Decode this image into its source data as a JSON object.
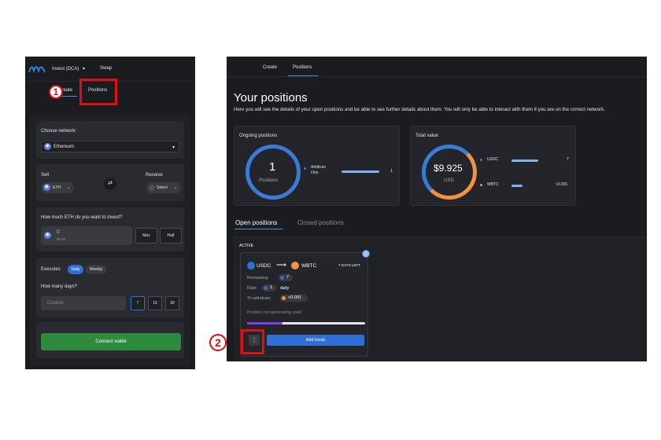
{
  "left_panel": {
    "nav": {
      "invest": "Invest (DCA)",
      "invest_caret": "▾",
      "swap": "Swap"
    },
    "tabs": {
      "create": "Create",
      "positions": "Positions"
    },
    "network": {
      "label": "Choose network:",
      "value": "Ethereum",
      "caret": "▾"
    },
    "swap": {
      "sell_label": "Sell",
      "sell_token": "ETH",
      "receive_label": "Receive",
      "receive_value": "Select",
      "switch_icon": "⇄"
    },
    "invest": {
      "label": "How much ETH do you want to invest?",
      "amount": "0",
      "usd": "$0.00",
      "max": "Max",
      "half": "Half"
    },
    "executes": {
      "label": "Executes",
      "daily": "Daily",
      "weekly": "Weekly"
    },
    "days": {
      "label": "How many days?",
      "placeholder": "Custom",
      "options": [
        "7",
        "15",
        "30"
      ]
    },
    "connect": "Connect wallet"
  },
  "markers": {
    "one": "1",
    "two": "2"
  },
  "right_panel": {
    "tabs": {
      "create": "Create",
      "positions": "Positions"
    },
    "title": "Your positions",
    "description": "Here you will see the details of your open positions and be able to see further details about them. You will only be able to interact with them if you are on the correct network.",
    "ongoing": {
      "label": "Ongoing positions",
      "count": "1",
      "sub": "Positions",
      "network": "Arbitrum One",
      "network_count": "1"
    },
    "total": {
      "label": "Total value",
      "value": "$9.925",
      "currency": "USD",
      "usdc_label": "USDC",
      "usdc_value": "7",
      "wbtc_label": "WBTC",
      "wbtc_value": "<0.001"
    },
    "position_tabs": {
      "open": "Open positions",
      "closed": "Closed positions"
    },
    "active_label": "ACTIVE",
    "position": {
      "from": "USDC",
      "to": "WBTC",
      "arrow": "⟶",
      "days_left": "7 DAYS LEFT",
      "remaining_label": "Remaining:",
      "remaining_value": "7",
      "rate_label": "Rate:",
      "rate_value": "1",
      "rate_suffix": "daily",
      "withdraw_label": "To withdraw:",
      "withdraw_value": "<0.001",
      "yield_note": "Position not generating yield",
      "progress": 0.3,
      "menu_icon": "⋮",
      "add_funds": "Add funds"
    }
  },
  "colors": {
    "accent": "#2f6fd6",
    "green": "#2e8b3d",
    "usdc": "#2775ca",
    "wbtc": "#f09242",
    "purple": "#7b3fe4",
    "marker": "#e01010"
  }
}
